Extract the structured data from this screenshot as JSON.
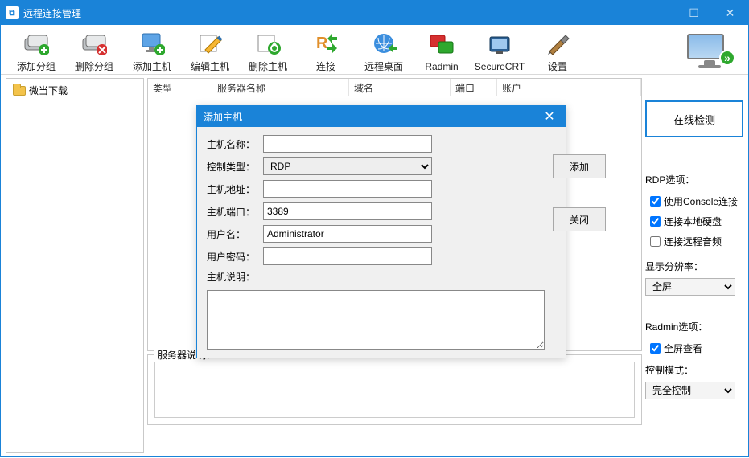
{
  "window": {
    "title": "远程连接管理"
  },
  "toolbar": {
    "items": [
      {
        "label": "添加分组",
        "icon": "add-group-icon"
      },
      {
        "label": "删除分组",
        "icon": "delete-group-icon"
      },
      {
        "label": "添加主机",
        "icon": "add-host-icon"
      },
      {
        "label": "编辑主机",
        "icon": "edit-host-icon"
      },
      {
        "label": "删除主机",
        "icon": "delete-host-icon"
      },
      {
        "label": "连接",
        "icon": "connect-icon"
      },
      {
        "label": "远程桌面",
        "icon": "remote-desktop-icon"
      },
      {
        "label": "Radmin",
        "icon": "radmin-icon"
      },
      {
        "label": "SecureCRT",
        "icon": "securecrt-icon"
      },
      {
        "label": "设置",
        "icon": "settings-icon"
      }
    ]
  },
  "tree": {
    "root_label": "微当下载"
  },
  "list": {
    "columns": {
      "type": "类型",
      "server_name": "服务器名称",
      "domain": "域名",
      "port": "端口",
      "account": "账户"
    }
  },
  "dialog": {
    "title": "添加主机",
    "labels": {
      "host_name": "主机名称：",
      "control_type": "控制类型：",
      "host_addr": "主机地址：",
      "host_port": "主机端口：",
      "username": "用户名：",
      "password": "用户密码：",
      "host_desc": "主机说明："
    },
    "values": {
      "host_name": "",
      "control_type": "RDP",
      "host_addr": "",
      "host_port": "3389",
      "username": "Administrator",
      "password": "",
      "host_desc": ""
    },
    "buttons": {
      "add": "添加",
      "close": "关闭"
    }
  },
  "server_desc_label": "服务器说明：",
  "right": {
    "detect": "在线检测",
    "rdp_title": "RDP选项：",
    "rdp_console": "使用Console连接",
    "rdp_disk": "连接本地硬盘",
    "rdp_audio": "连接远程音频",
    "resolution_title": "显示分辨率：",
    "resolution_value": "全屏",
    "radmin_title": "Radmin选项：",
    "radmin_fullscreen": "全屏查看",
    "control_mode_title": "控制模式：",
    "control_mode_value": "完全控制"
  },
  "checks": {
    "rdp_console": true,
    "rdp_disk": true,
    "rdp_audio": false,
    "radmin_fullscreen": true
  }
}
